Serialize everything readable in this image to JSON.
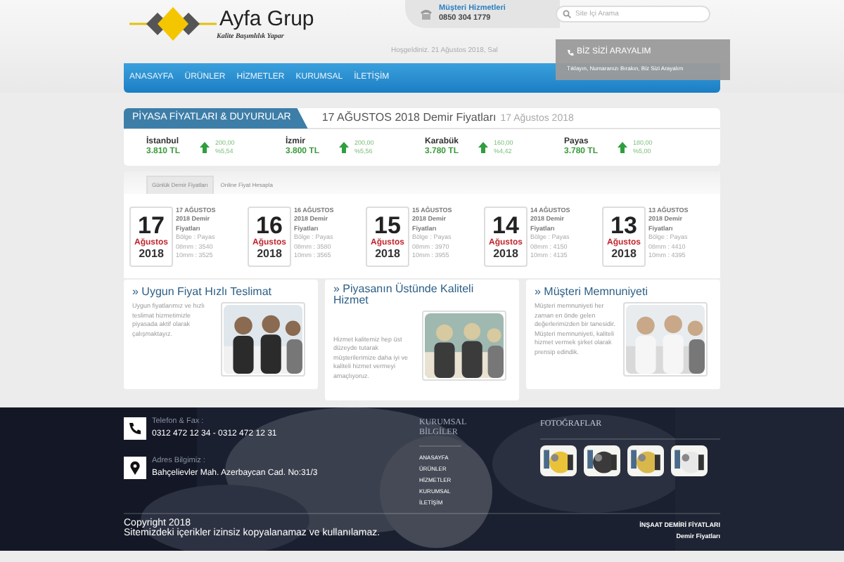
{
  "logo": {
    "name": "Ayfa Grup",
    "slogan": "Kalite Başımlılık Yapar"
  },
  "customer_service": {
    "title": "Müşteri Hizmetleri",
    "phone": "0850 304 1779"
  },
  "search": {
    "placeholder": "Site İçi Arama"
  },
  "welcome": "Hoşgeldiniz. 21 Ağustos 2018, Sal",
  "callback": {
    "title": "BİZ SİZİ ARAYALIM",
    "text": "Tıklayın, Numaranızı Bırakın, Biz Sizi Arayalım"
  },
  "nav": [
    "ANASAYFA",
    "ÜRÜNLER",
    "HİZMETLER",
    "KURUMSAL",
    "İLETİŞİM"
  ],
  "market": {
    "heading": "PİYASA FİYATLARI & DUYURULAR",
    "title": "17 AĞUSTOS 2018 Demir Fiyatları",
    "date": "17 Ağustos 2018",
    "prices": [
      {
        "city": "İstanbul",
        "price": "3.810 TL",
        "change": "200,00",
        "percent": "%5,54"
      },
      {
        "city": "İzmir",
        "price": "3.800 TL",
        "change": "200,00",
        "percent": "%5,56"
      },
      {
        "city": "Karabük",
        "price": "3.780 TL",
        "change": "160,00",
        "percent": "%4,42"
      },
      {
        "city": "Payas",
        "price": "3.780 TL",
        "change": "180,00",
        "percent": "%5,00"
      }
    ]
  },
  "tabs": [
    {
      "label": "Günlük Demir Fiyatları",
      "selected": true
    },
    {
      "label": "Online Fiyat Hesapla",
      "selected": false
    }
  ],
  "daily": [
    {
      "day": "17",
      "month": "Ağustos",
      "year": "2018",
      "title": "17 AĞUSTOS 2018 Demir Fiyatları",
      "region": "Bölge : Payas",
      "mm8": "08mm : 3540",
      "mm10": "10mm : 3525"
    },
    {
      "day": "16",
      "month": "Ağustos",
      "year": "2018",
      "title": "16 AĞUSTOS 2018 Demir Fiyatları",
      "region": "Bölge : Payas",
      "mm8": "08mm : 3580",
      "mm10": "10mm : 3565"
    },
    {
      "day": "15",
      "month": "Ağustos",
      "year": "2018",
      "title": "15 AĞUSTOS 2018 Demir Fiyatları",
      "region": "Bölge : Payas",
      "mm8": "08mm : 3970",
      "mm10": "10mm : 3955"
    },
    {
      "day": "14",
      "month": "Ağustos",
      "year": "2018",
      "title": "14 AĞUSTOS 2018 Demir Fiyatları",
      "region": "Bölge : Payas",
      "mm8": "08mm : 4150",
      "mm10": "10mm : 4135"
    },
    {
      "day": "13",
      "month": "Ağustos",
      "year": "2018",
      "title": "13 AĞUSTOS 2018 Demir Fiyatları",
      "region": "Bölge : Payas",
      "mm8": "08mm : 4410",
      "mm10": "10mm : 4395"
    }
  ],
  "features": [
    {
      "title": "» Uygun Fiyat Hızlı Teslimat",
      "text": "Uygun fiyatlarımız ve hızlı teslimat hizmetimizle piyasada aktif olarak çalışmaktayız.",
      "kind": "picture"
    },
    {
      "title": "» Piyasanın Üstünde Kaliteli Hizmet",
      "text": "Hizmet kalitemiz hep üst düzeyde tutarak müşterilerimize daha iyi ve kaliteli hizmet vermeyi amaçlıyoruz.",
      "kind": "picture"
    },
    {
      "title": "» Müşteri Memnuniyeti",
      "text": "Müşteri memnuniyeti her zaman en önde gelen değerlerimizden bir tanesidir. Müşteri memnuniyeti, kaliteli hizmet vermek şirket olarak prensip edindik.",
      "kind": "picture"
    }
  ],
  "footer": {
    "contacts": [
      {
        "kind": "phone",
        "label": "Telefon & Fax :",
        "value": "0312 472 12 34 - 0312 472 12 31"
      },
      {
        "kind": "address",
        "label": "Adres Bilgimiz :",
        "value": "Bahçelievler Mah. Azerbaycan Cad. No:31/3"
      }
    ],
    "links_title": "KURUMSAL BİLGİLER",
    "links": [
      "ANASAYFA",
      "ÜRÜNLER",
      "HİZMETLER",
      "KURUMSAL",
      "İLETİŞİM"
    ],
    "photos_title": "FOTOĞRAFLAR",
    "photos": [
      {
        "kind": "picture"
      },
      {
        "kind": "picture"
      },
      {
        "kind": "picture"
      },
      {
        "kind": "picture"
      }
    ],
    "copyright": [
      "Copyright 2018",
      "Sitemizdeki içerikler izinsiz kopyalanamaz ve kullanılamaz."
    ],
    "right_links": [
      "İNŞAAT DEMİRİ FİYATLARI",
      "Demir Fiyatları"
    ]
  }
}
